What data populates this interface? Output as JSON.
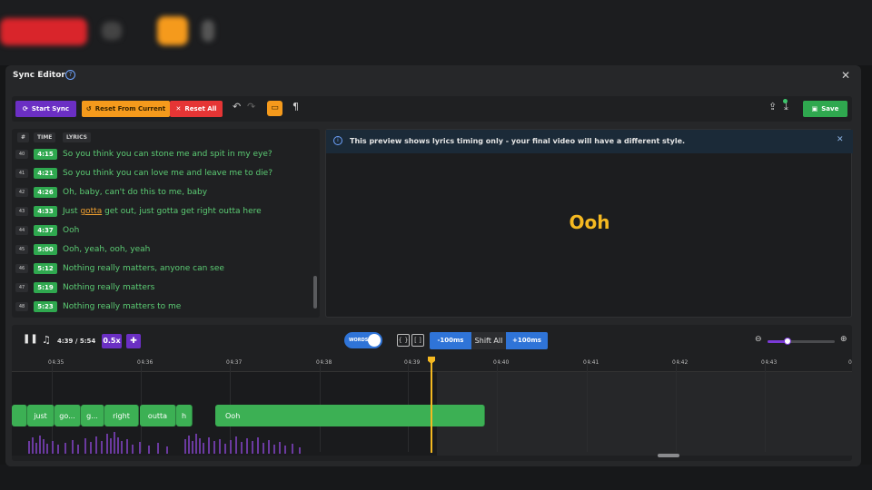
{
  "app": {
    "modal_title": "Sync Editor",
    "help_icon": "help-circle-icon",
    "close_icon": "close-icon"
  },
  "toolbar": {
    "start_sync": "Start Sync",
    "reset_from_current": "Reset From Current",
    "reset_all": "Reset All",
    "save": "Save"
  },
  "lyrics": {
    "headers": {
      "num": "#",
      "time": "TIME",
      "lyrics": "LYRICS"
    },
    "rows": [
      {
        "num": "40",
        "time": "4:15",
        "text": "So you think you can stone me and spit in my eye?"
      },
      {
        "num": "41",
        "time": "4:21",
        "text": "So you think you can love me and leave me to die?"
      },
      {
        "num": "42",
        "time": "4:26",
        "text": "Oh, baby, can't do this to me, baby"
      },
      {
        "num": "43",
        "time": "4:33",
        "pre": "Just ",
        "highlight": "gotta",
        "post": " get out, just gotta get right outta here"
      },
      {
        "num": "44",
        "time": "4:37",
        "text": "Ooh"
      },
      {
        "num": "45",
        "time": "5:00",
        "text": "Ooh, yeah, ooh, yeah"
      },
      {
        "num": "46",
        "time": "5:12",
        "text": "Nothing really matters, anyone can see"
      },
      {
        "num": "47",
        "time": "5:19",
        "text": "Nothing really matters"
      },
      {
        "num": "48",
        "time": "5:23",
        "text": "Nothing really matters to me"
      }
    ]
  },
  "preview": {
    "info": "This preview shows lyrics timing only - your final video will have a different style.",
    "current_word": "Ooh"
  },
  "timeline": {
    "time_readout": "4:39 / 5:54",
    "speed": "0.5x",
    "words_toggle": "WORDS",
    "words_toggle_on": true,
    "shift_minus": "-100ms",
    "shift_label": "Shift All",
    "shift_plus": "+100ms",
    "zoom_level": 0.3,
    "ticks": [
      "04:35",
      "04:36",
      "04:37",
      "04:38",
      "04:39",
      "04:40",
      "04:41",
      "04:42",
      "04:43",
      "0"
    ],
    "words": [
      "",
      "just",
      "go...",
      "g...",
      "right",
      "outta",
      "h",
      "Ooh"
    ],
    "playhead_time": "04:39"
  },
  "colors": {
    "accent_purple": "#6b2fc4",
    "accent_orange": "#f59a1c",
    "danger": "#e53535",
    "success": "#2fa84f",
    "blue": "#2f74d8",
    "preview_word": "#f5b921"
  }
}
